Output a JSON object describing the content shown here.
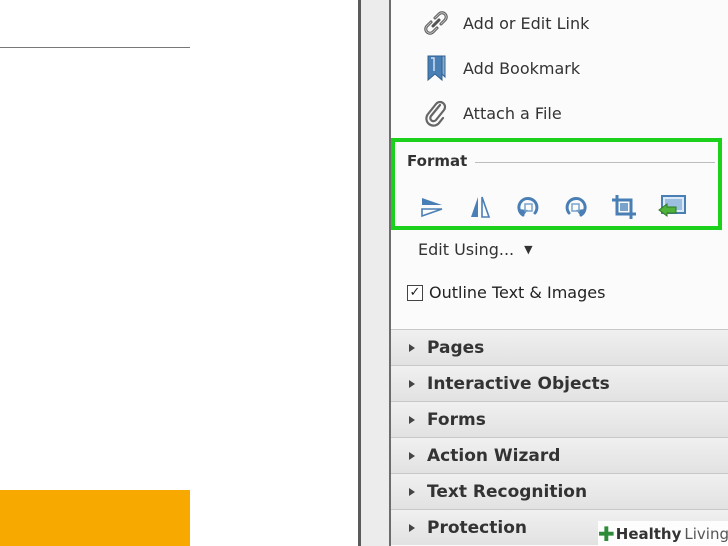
{
  "tools": [
    {
      "label": "Add or Edit Link",
      "icon": "link-icon"
    },
    {
      "label": "Add Bookmark",
      "icon": "bookmark-icon"
    },
    {
      "label": "Attach a File",
      "icon": "paperclip-icon"
    }
  ],
  "format": {
    "title": "Format",
    "icons": [
      "flip-vertical-icon",
      "flip-horizontal-icon",
      "rotate-counterclockwise-icon",
      "rotate-clockwise-icon",
      "crop-icon",
      "replace-image-icon"
    ],
    "highlight_color": "#1bd11b"
  },
  "edit_using": {
    "label": "Edit Using..."
  },
  "outline": {
    "label": "Outline Text & Images",
    "checked": true
  },
  "sections": [
    {
      "label": "Pages"
    },
    {
      "label": "Interactive Objects"
    },
    {
      "label": "Forms"
    },
    {
      "label": "Action Wizard"
    },
    {
      "label": "Text Recognition"
    },
    {
      "label": "Protection"
    }
  ],
  "watermark": {
    "part1": "Healthy",
    "part2": "Living"
  },
  "colors": {
    "accent_orange": "#f7a900",
    "icon_blue": "#4a7fb5"
  }
}
